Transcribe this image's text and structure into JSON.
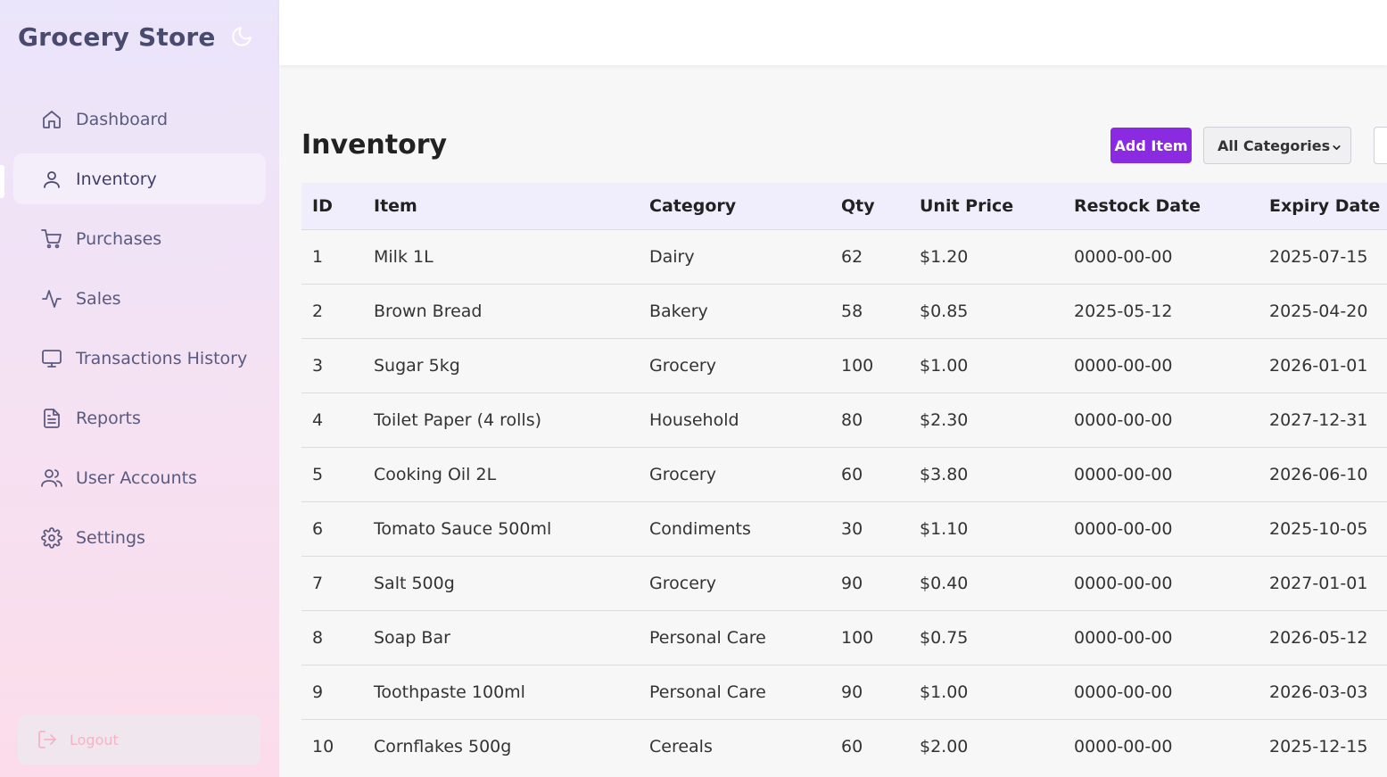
{
  "app": {
    "title": "Grocery Store"
  },
  "sidebar": {
    "items": [
      {
        "label": "Dashboard",
        "icon": "home-icon"
      },
      {
        "label": "Inventory",
        "icon": "user-icon",
        "active": true
      },
      {
        "label": "Purchases",
        "icon": "cart-icon"
      },
      {
        "label": "Sales",
        "icon": "activity-icon"
      },
      {
        "label": "Transactions History",
        "icon": "monitor-icon"
      },
      {
        "label": "Reports",
        "icon": "file-text-icon"
      },
      {
        "label": "User Accounts",
        "icon": "users-icon"
      },
      {
        "label": "Settings",
        "icon": "gear-icon"
      }
    ],
    "logout_label": "Logout"
  },
  "main": {
    "title": "Inventory",
    "add_button": "Add Item",
    "category_filter": {
      "selected": "All Categories"
    },
    "table": {
      "headers": [
        "ID",
        "Item",
        "Category",
        "Qty",
        "Unit Price",
        "Restock Date",
        "Expiry Date"
      ],
      "rows": [
        [
          "1",
          "Milk 1L",
          "Dairy",
          "62",
          "$1.20",
          "0000-00-00",
          "2025-07-15"
        ],
        [
          "2",
          "Brown Bread",
          "Bakery",
          "58",
          "$0.85",
          "2025-05-12",
          "2025-04-20"
        ],
        [
          "3",
          "Sugar 5kg",
          "Grocery",
          "100",
          "$1.00",
          "0000-00-00",
          "2026-01-01"
        ],
        [
          "4",
          "Toilet Paper (4 rolls)",
          "Household",
          "80",
          "$2.30",
          "0000-00-00",
          "2027-12-31"
        ],
        [
          "5",
          "Cooking Oil 2L",
          "Grocery",
          "60",
          "$3.80",
          "0000-00-00",
          "2026-06-10"
        ],
        [
          "6",
          "Tomato Sauce 500ml",
          "Condiments",
          "30",
          "$1.10",
          "0000-00-00",
          "2025-10-05"
        ],
        [
          "7",
          "Salt 500g",
          "Grocery",
          "90",
          "$0.40",
          "0000-00-00",
          "2027-01-01"
        ],
        [
          "8",
          "Soap Bar",
          "Personal Care",
          "100",
          "$0.75",
          "0000-00-00",
          "2026-05-12"
        ],
        [
          "9",
          "Toothpaste 100ml",
          "Personal Care",
          "90",
          "$1.00",
          "0000-00-00",
          "2026-03-03"
        ],
        [
          "10",
          "Cornflakes 500g",
          "Cereals",
          "60",
          "$2.00",
          "0000-00-00",
          "2025-12-15"
        ]
      ]
    }
  },
  "colors": {
    "accent": "#8a2be2",
    "sidebar_text": "#5a5a80",
    "header_row": "#f0eefc"
  }
}
